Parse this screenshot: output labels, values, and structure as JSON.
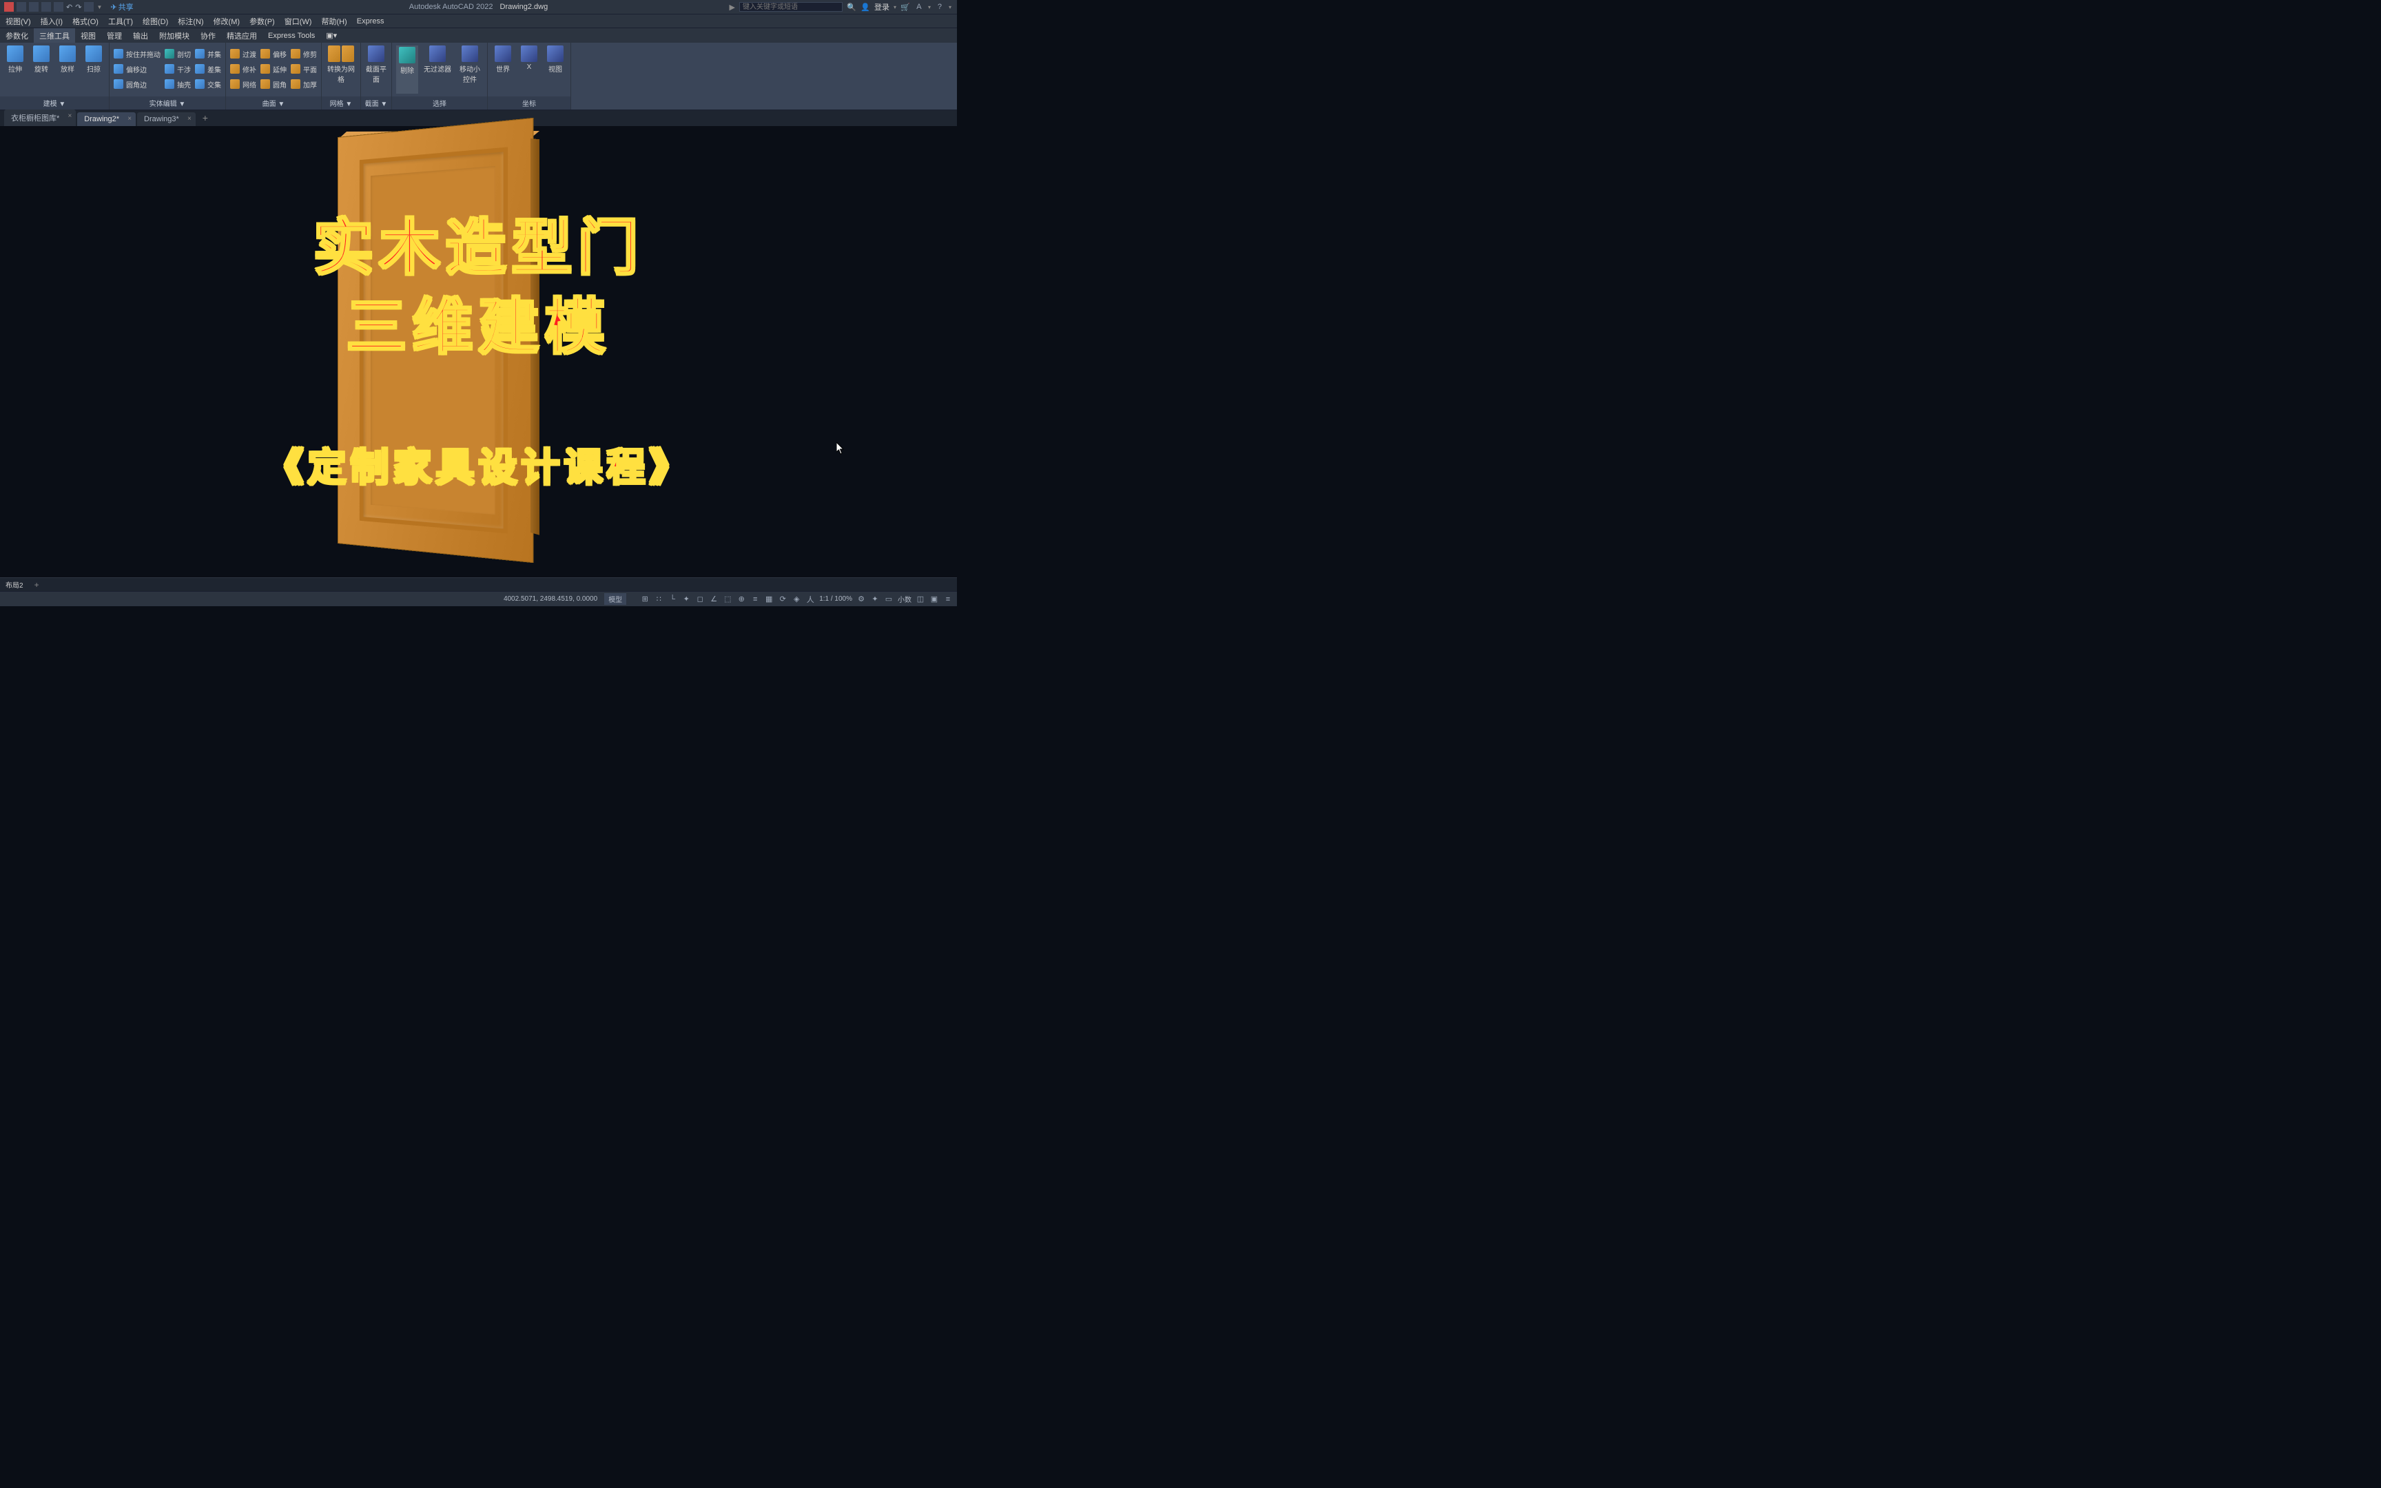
{
  "titlebar": {
    "share": "共享",
    "app_title": "Autodesk AutoCAD 2022",
    "doc_title": "Drawing2.dwg",
    "search_placeholder": "键入关键字或短语",
    "login": "登录"
  },
  "menubar": {
    "items": [
      "视图(V)",
      "插入(I)",
      "格式(O)",
      "工具(T)",
      "绘图(D)",
      "标注(N)",
      "修改(M)",
      "参数(P)",
      "窗口(W)",
      "帮助(H)",
      "Express"
    ]
  },
  "ribbon_tabs": [
    "参数化",
    "三维工具",
    "视图",
    "管理",
    "输出",
    "附加模块",
    "协作",
    "精选应用",
    "Express Tools"
  ],
  "ribbon_active": "三维工具",
  "ribbon": {
    "panels": [
      {
        "title": "建模 ▼",
        "big": [
          {
            "label": "拉伸",
            "color": "blue"
          },
          {
            "label": "旋转",
            "color": "blue"
          },
          {
            "label": "放样",
            "color": "blue"
          },
          {
            "label": "扫掠",
            "color": "blue"
          }
        ]
      },
      {
        "title": "实体编辑 ▼",
        "rows": [
          [
            {
              "icon": "blue",
              "label": "按住并拖动"
            },
            {
              "icon": "teal",
              "label": "剖切"
            },
            {
              "icon": "blue",
              "label": "并集"
            }
          ],
          [
            {
              "icon": "blue",
              "label": "偏移边"
            },
            {
              "icon": "blue",
              "label": "干涉"
            },
            {
              "icon": "blue",
              "label": "差集"
            }
          ],
          [
            {
              "icon": "blue",
              "label": "圆角边"
            },
            {
              "icon": "blue",
              "label": "抽壳"
            },
            {
              "icon": "blue",
              "label": "交集"
            }
          ]
        ]
      },
      {
        "title": "曲面 ▼",
        "rows": [
          [
            {
              "icon": "gold",
              "label": "过渡"
            },
            {
              "icon": "gold",
              "label": "偏移"
            },
            {
              "icon": "gold",
              "label": "修剪"
            }
          ],
          [
            {
              "icon": "gold",
              "label": "修补"
            },
            {
              "icon": "gold",
              "label": "延伸"
            },
            {
              "icon": "gold",
              "label": "平面"
            }
          ],
          [
            {
              "icon": "gold",
              "label": "网络"
            },
            {
              "icon": "gold",
              "label": "圆角"
            },
            {
              "icon": "gold",
              "label": "加厚"
            }
          ]
        ]
      },
      {
        "title": "网格 ▼",
        "big": [
          {
            "label": "转换为网格",
            "color": "gold",
            "wide": true
          }
        ]
      },
      {
        "title": "截面 ▼",
        "big": [
          {
            "label": "截面平面",
            "color": "navy"
          }
        ]
      },
      {
        "title": "选择",
        "big": [
          {
            "label": "剔除",
            "color": "teal",
            "active": true
          },
          {
            "label": "无过滤器",
            "color": "navy"
          },
          {
            "label": "移动小控件",
            "color": "navy"
          }
        ]
      },
      {
        "title": "坐标",
        "big": [
          {
            "label": "世界",
            "color": "navy"
          },
          {
            "label": "X",
            "color": "navy"
          },
          {
            "label": "视图",
            "color": "navy"
          }
        ]
      }
    ]
  },
  "doc_tabs": [
    {
      "label": "衣柜橱柜图库*",
      "active": false
    },
    {
      "label": "Drawing2*",
      "active": true
    },
    {
      "label": "Drawing3*",
      "active": false
    }
  ],
  "overlay": {
    "line1": "实木造型门",
    "line2": "三维建模",
    "line3": "《定制家具设计课程》"
  },
  "layout_tabs": {
    "tabs": [
      "布局2"
    ]
  },
  "statusbar": {
    "coords": "4002.5071, 2498.4519, 0.0000",
    "model": "模型",
    "ratio": "1:1 / 100%",
    "scale": "小数",
    "icons": [
      "grid-icon",
      "snap-icon",
      "ortho-icon",
      "polar-icon",
      "osnap-icon",
      "track-icon",
      "ducs-icon",
      "dyn-icon",
      "lw-icon",
      "transp-icon",
      "cycle-icon",
      "3dosnap-icon",
      "anno-icon",
      "workspace-icon",
      "monitor-icon",
      "iso-icon",
      "clean-icon",
      "custom-icon"
    ]
  }
}
